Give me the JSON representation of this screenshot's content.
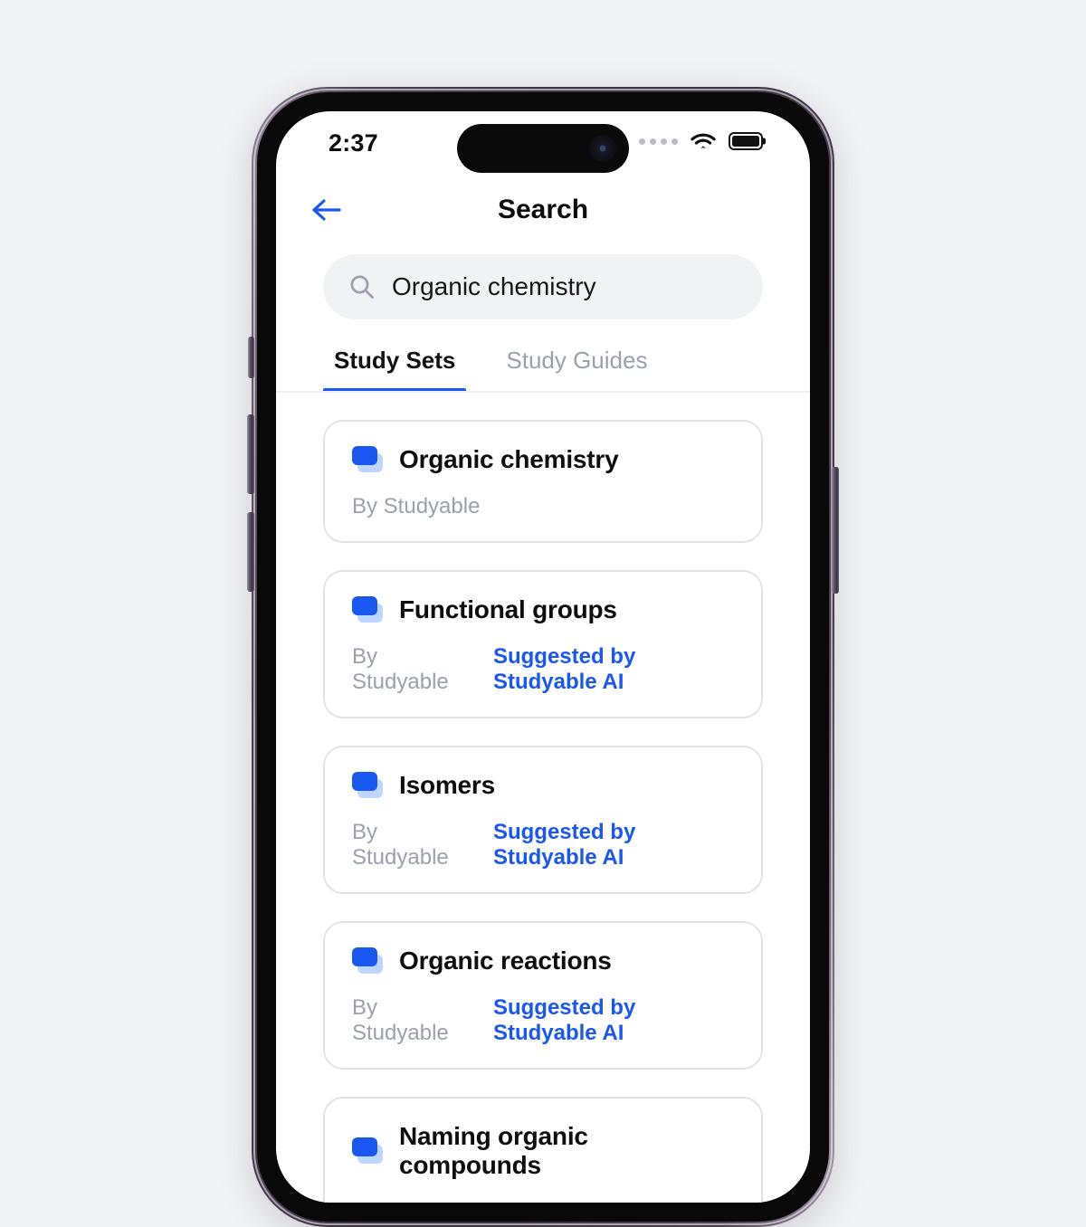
{
  "background_color": "#f1f3f5",
  "accent_color": "#1a56f0",
  "status_bar": {
    "time": "2:37",
    "cellular_icon": "cellular-dots-icon",
    "wifi_icon": "wifi-icon",
    "battery_icon": "battery-full-icon"
  },
  "nav": {
    "back_icon": "arrow-left-icon",
    "title": "Search"
  },
  "search": {
    "icon": "search-icon",
    "value": "Organic chemistry",
    "placeholder": "Search"
  },
  "tabs": [
    {
      "label": "Study Sets",
      "active": true
    },
    {
      "label": "Study Guides",
      "active": false
    }
  ],
  "results": [
    {
      "icon": "card-stack-icon",
      "title": "Organic chemistry",
      "author": "By Studyable",
      "suggested": ""
    },
    {
      "icon": "card-stack-icon",
      "title": "Functional groups",
      "author": "By Studyable",
      "suggested": "Suggested by Studyable AI"
    },
    {
      "icon": "card-stack-icon",
      "title": "Isomers",
      "author": "By Studyable",
      "suggested": "Suggested by Studyable AI"
    },
    {
      "icon": "card-stack-icon",
      "title": "Organic reactions",
      "author": "By Studyable",
      "suggested": "Suggested by Studyable AI"
    },
    {
      "icon": "card-stack-icon",
      "title": "Naming organic compounds",
      "author": "",
      "suggested": ""
    }
  ]
}
